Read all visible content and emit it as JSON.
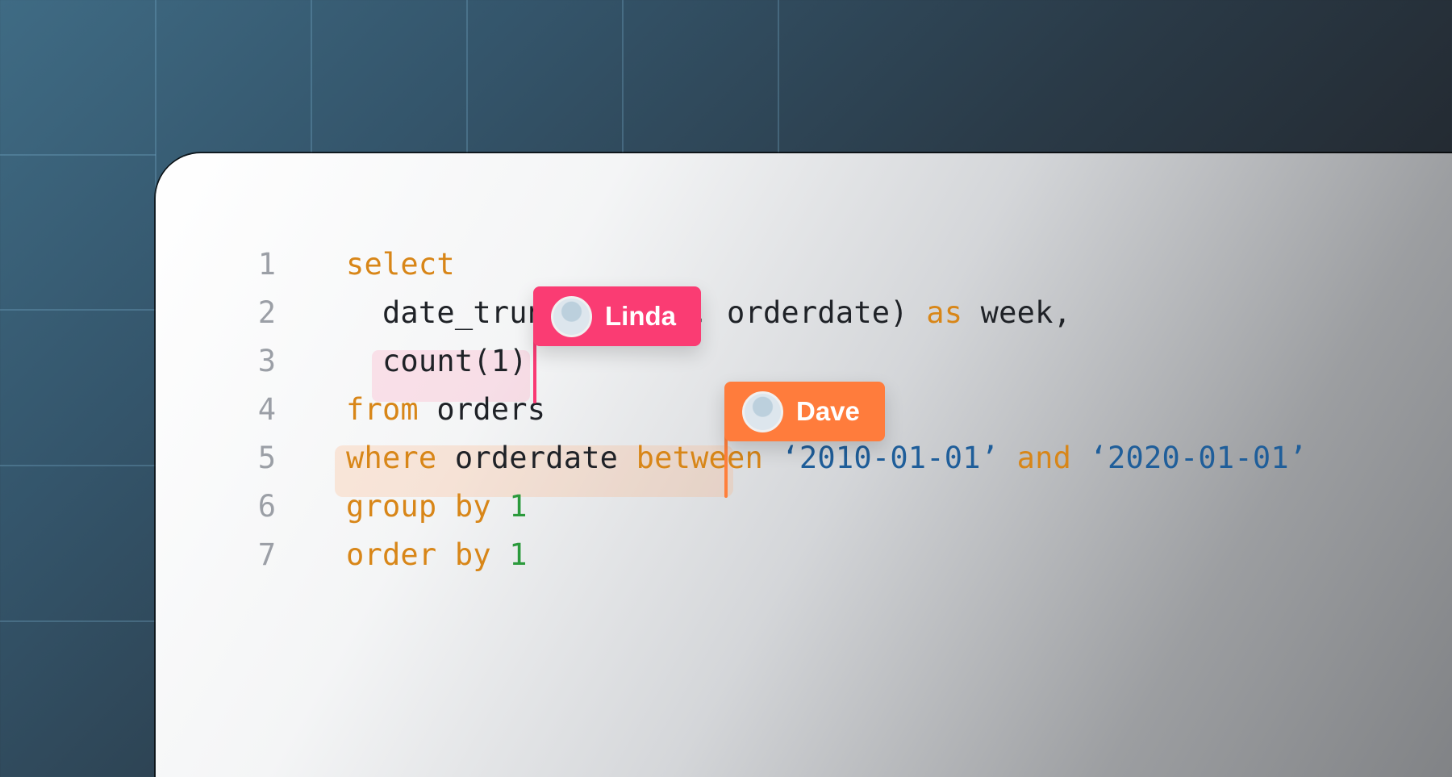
{
  "editor": {
    "lines": [
      {
        "number": "1",
        "tokens": [
          {
            "text": "select",
            "kind": "keyword"
          }
        ]
      },
      {
        "number": "2",
        "tokens": [
          {
            "text": "  date_trunc('week', ",
            "kind": "plain"
          },
          {
            "text": "orderdate) ",
            "kind": "plain"
          },
          {
            "text": "as",
            "kind": "keyword"
          },
          {
            "text": " week,",
            "kind": "plain"
          }
        ]
      },
      {
        "number": "3",
        "tokens": [
          {
            "text": "  count(1)",
            "kind": "plain"
          }
        ]
      },
      {
        "number": "4",
        "tokens": [
          {
            "text": "from",
            "kind": "keyword"
          },
          {
            "text": " orders",
            "kind": "plain"
          }
        ]
      },
      {
        "number": "5",
        "tokens": [
          {
            "text": "where",
            "kind": "keyword"
          },
          {
            "text": " orderdate ",
            "kind": "plain"
          },
          {
            "text": "between",
            "kind": "keyword"
          },
          {
            "text": " ‘2010-01-01’ ",
            "kind": "string"
          },
          {
            "text": "and",
            "kind": "keyword"
          },
          {
            "text": " ‘2020-01-01’",
            "kind": "string"
          }
        ]
      },
      {
        "number": "6",
        "tokens": [
          {
            "text": "group by",
            "kind": "keyword"
          },
          {
            "text": " 1",
            "kind": "number"
          }
        ]
      },
      {
        "number": "7",
        "tokens": [
          {
            "text": "order by",
            "kind": "keyword"
          },
          {
            "text": " 1",
            "kind": "number"
          }
        ]
      }
    ]
  },
  "collaborators": {
    "linda": {
      "name": "Linda",
      "color": "#fa3c73",
      "icon": "avatar-icon"
    },
    "dave": {
      "name": "Dave",
      "color": "#ff7c3c",
      "icon": "avatar-icon"
    }
  },
  "colors": {
    "keyword": "#d88618",
    "number": "#2b9a3c",
    "string": "#1f5e9a",
    "plain": "#1f2227",
    "line_number": "#9b9fa6"
  }
}
